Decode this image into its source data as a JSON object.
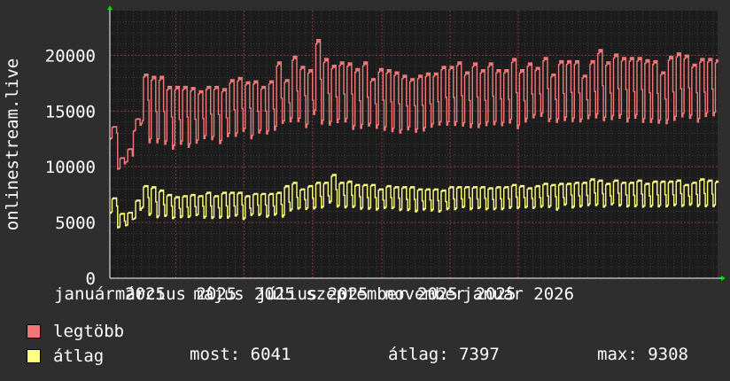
{
  "chart_data": {
    "type": "line",
    "ylabel": "onlinestream.live",
    "xlabel": "",
    "ylim": [
      0,
      24000
    ],
    "yticks": [
      0,
      5000,
      10000,
      15000,
      20000
    ],
    "ytick_labels": [
      "0",
      "5000",
      "10000",
      "15000",
      "20000"
    ],
    "x_start_day": 0,
    "x_end_day": 543,
    "xtick_labels": [
      {
        "label": "január 2025",
        "day": 0
      },
      {
        "label": "március 2025",
        "day": 59
      },
      {
        "label": "május 2025",
        "day": 120
      },
      {
        "label": "július 2025",
        "day": 181
      },
      {
        "label": "szeptember 2025",
        "day": 243
      },
      {
        "label": "november 2025",
        "day": 304
      },
      {
        "label": "január 2026",
        "day": 365
      }
    ],
    "grid": true,
    "series": [
      {
        "name": "legtöbb",
        "color": "#f07878",
        "x": [
          0,
          7,
          14,
          21,
          28,
          35,
          42,
          49,
          56,
          63,
          70,
          77,
          84,
          91,
          98,
          105,
          112,
          119,
          126,
          133,
          140,
          147,
          154,
          161,
          168,
          175,
          182,
          189,
          196,
          203,
          210,
          217,
          224,
          231,
          238,
          245,
          252,
          259,
          266,
          273,
          280,
          287,
          294,
          301,
          308,
          315,
          322,
          329,
          336,
          343,
          350,
          357,
          364,
          371,
          378,
          385,
          392,
          399,
          406,
          413,
          420,
          427,
          434,
          441,
          448,
          455,
          462,
          469,
          476,
          483,
          490,
          497,
          504,
          511,
          518,
          525,
          532,
          539
        ],
        "peak": [
          13600,
          10800,
          11600,
          14300,
          18300,
          18100,
          18100,
          17200,
          17200,
          17200,
          17100,
          16800,
          17200,
          17200,
          17000,
          17800,
          18000,
          17600,
          17700,
          17200,
          17700,
          19400,
          17800,
          19900,
          19000,
          18700,
          21400,
          19700,
          19100,
          19400,
          19300,
          18800,
          19400,
          17900,
          18800,
          18700,
          18500,
          18200,
          17900,
          18200,
          18400,
          18400,
          19000,
          19000,
          19400,
          18500,
          19300,
          18700,
          19300,
          18700,
          18700,
          19700,
          18700,
          19300,
          18900,
          19800,
          18300,
          19500,
          19500,
          19500,
          18200,
          19500,
          20500,
          19400,
          20100,
          19800,
          19800,
          19800,
          19600,
          19500,
          18500,
          19900,
          20200,
          20000,
          19200,
          19700,
          19700,
          19600
        ],
        "low": [
          12300,
          9600,
          10200,
          13000,
          13100,
          11100,
          11100,
          11100,
          10600,
          11100,
          10800,
          11300,
          11700,
          11600,
          11200,
          11800,
          11800,
          12400,
          11600,
          12300,
          12100,
          12200,
          13200,
          13000,
          13200,
          12600,
          13500,
          12800,
          12800,
          13000,
          13100,
          12400,
          12400,
          12900,
          12500,
          12300,
          12200,
          12100,
          12500,
          12200,
          12300,
          12700,
          12800,
          12800,
          12700,
          12800,
          12500,
          12600,
          12700,
          12900,
          12800,
          12900,
          12500,
          13100,
          13600,
          13600,
          13300,
          13000,
          13200,
          13100,
          13300,
          13400,
          13300,
          13200,
          13200,
          13400,
          13000,
          13400,
          13000,
          13000,
          13100,
          12800,
          13100,
          13500,
          13500,
          13000,
          13600,
          13700
        ]
      },
      {
        "name": "átlag",
        "color": "#ffff80",
        "x": [
          0,
          7,
          14,
          21,
          28,
          35,
          42,
          49,
          56,
          63,
          70,
          77,
          84,
          91,
          98,
          105,
          112,
          119,
          126,
          133,
          140,
          147,
          154,
          161,
          168,
          175,
          182,
          189,
          196,
          203,
          210,
          217,
          224,
          231,
          238,
          245,
          252,
          259,
          266,
          273,
          280,
          287,
          294,
          301,
          308,
          315,
          322,
          329,
          336,
          343,
          350,
          357,
          364,
          371,
          378,
          385,
          392,
          399,
          406,
          413,
          420,
          427,
          434,
          441,
          448,
          455,
          462,
          469,
          476,
          483,
          490,
          497,
          504,
          511,
          518,
          525,
          532,
          539
        ],
        "peak": [
          7200,
          5800,
          5900,
          7000,
          8300,
          8200,
          7900,
          7500,
          7300,
          7400,
          7500,
          7400,
          7700,
          7400,
          7700,
          7700,
          7700,
          7400,
          7600,
          7600,
          7600,
          7700,
          8300,
          8600,
          8000,
          8300,
          8600,
          8600,
          9300,
          8600,
          8700,
          8400,
          8400,
          8400,
          8000,
          8300,
          8200,
          8200,
          8200,
          8000,
          8000,
          8000,
          7900,
          8200,
          8200,
          8200,
          8200,
          8200,
          8100,
          8200,
          8200,
          8400,
          8300,
          8100,
          8300,
          8500,
          8400,
          8500,
          8500,
          8600,
          8600,
          8900,
          8800,
          8500,
          8800,
          8600,
          8600,
          8800,
          8500,
          8700,
          8700,
          8700,
          8800,
          8400,
          8600,
          8900,
          8800,
          8700
        ],
        "low": [
          5600,
          4300,
          4500,
          5000,
          5900,
          5200,
          5000,
          5200,
          5000,
          5100,
          5100,
          5300,
          5000,
          5000,
          5000,
          5000,
          5200,
          4900,
          5300,
          5300,
          5100,
          5300,
          5000,
          5600,
          5900,
          5800,
          5800,
          5900,
          6300,
          6000,
          5900,
          6000,
          5800,
          5800,
          5800,
          5900,
          5900,
          5700,
          5700,
          5600,
          5800,
          5700,
          5600,
          5800,
          5800,
          6000,
          5800,
          5900,
          5800,
          5800,
          5800,
          5900,
          5900,
          6000,
          5900,
          6000,
          6000,
          5700,
          6200,
          5900,
          6000,
          6100,
          6100,
          6000,
          6200,
          6100,
          6000,
          6000,
          6000,
          6000,
          6000,
          6000,
          6100,
          6100,
          6200,
          6000,
          6000,
          6041
        ]
      }
    ]
  },
  "legend": [
    {
      "label": "legtöbb",
      "color": "#f07878"
    },
    {
      "label": "átlag",
      "color": "#ffff80"
    }
  ],
  "stats": {
    "most": "most: 6041",
    "atlag": "átlag: 7397",
    "max": "max: 9308"
  },
  "colors": {
    "background": "#2e2e2e",
    "plot_background": "#1c1c1c",
    "text": "#ffffff",
    "axis_arrow": "#00dd00",
    "grid_major": "#7a3a3a",
    "grid_minor": "#3a3a3a"
  }
}
